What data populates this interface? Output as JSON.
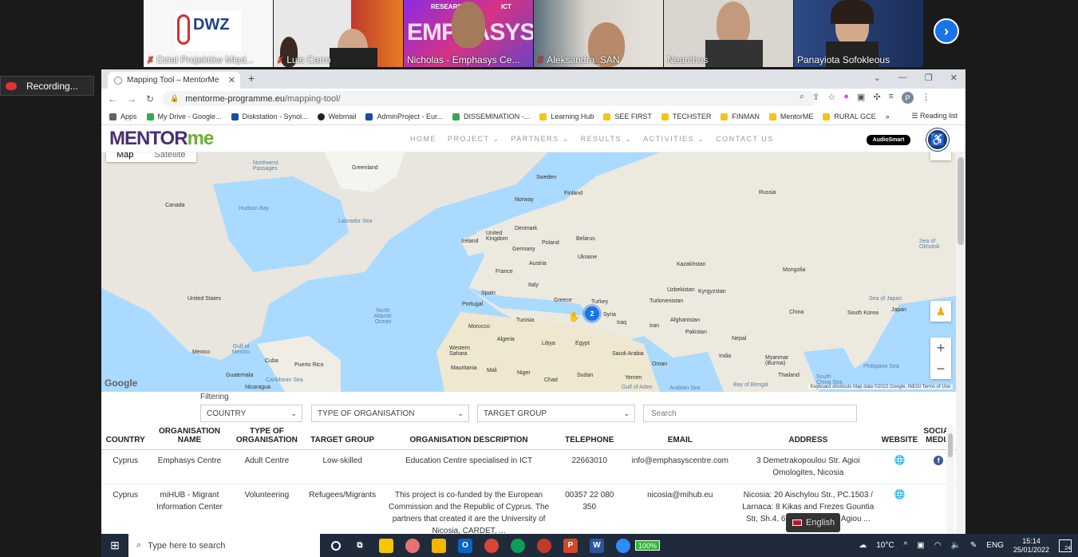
{
  "meeting": {
    "participants": [
      {
        "name": "Dział Projektów Międ...",
        "muted": true,
        "logo_text": "DWZ"
      },
      {
        "name": "Luis Carro",
        "muted": true
      },
      {
        "name": "Nicholas - Emphasys Ce...",
        "muted": false,
        "banner": "EMPHASYS",
        "banner_top": "RESEARCH",
        "banner_ict": "ICT"
      },
      {
        "name": "Aleksandra_SAN",
        "muted": true
      },
      {
        "name": "Nearchos",
        "muted": false
      },
      {
        "name": "Panayiota Sofokleous",
        "muted": false
      }
    ],
    "recording_label": "Recording...",
    "next_icon": "chevron-right-icon"
  },
  "browser": {
    "tab_title": "Mapping Tool – MentorMe",
    "url_host": "mentorme-programme.eu",
    "url_path": "/mapping-tool/",
    "profile_initial": "P",
    "bookmarks": [
      {
        "label": "Apps",
        "color": "#5f6368"
      },
      {
        "label": "My Drive - Google...",
        "color": "#34a853"
      },
      {
        "label": "Diskstation - Synol...",
        "color": "#1a4d9c"
      },
      {
        "label": "Webmail",
        "color": "#222222"
      },
      {
        "label": "AdminProject - Eur...",
        "color": "#1a4d9c"
      },
      {
        "label": "DISSEMINATION -...",
        "color": "#34a853"
      },
      {
        "label": "Learning Hub",
        "color": "#f5c518"
      },
      {
        "label": "SEE FIRST",
        "color": "#f5c518"
      },
      {
        "label": "TECHSTER",
        "color": "#f5c518"
      },
      {
        "label": "FINMAN",
        "color": "#f5c518"
      },
      {
        "label": "MentorME",
        "color": "#f5c518"
      },
      {
        "label": "RURAL GCE",
        "color": "#f5c518"
      }
    ],
    "bookmarks_more": "»",
    "reading_list": "Reading list"
  },
  "site": {
    "logo_main": "MENTOR",
    "logo_accent": "me",
    "nav": [
      "HOME",
      "PROJECT",
      "PARTNERS",
      "RESULTS",
      "ACTIVITIES",
      "CONTACT US"
    ],
    "nav_dropdowns": [
      false,
      true,
      true,
      true,
      true,
      false
    ],
    "sponsor": "AudioSmart"
  },
  "map": {
    "type_map": "Map",
    "type_satellite": "Satellite",
    "cluster_count": "2",
    "labels": [
      {
        "text": "Greenland",
        "water": false
      },
      {
        "text": "Sweden",
        "water": false
      },
      {
        "text": "Finland",
        "water": false
      },
      {
        "text": "Russia",
        "water": false
      },
      {
        "text": "Norway",
        "water": false
      },
      {
        "text": "Canada",
        "water": false
      },
      {
        "text": "Hudson Bay",
        "water": true
      },
      {
        "text": "Labrador Sea",
        "water": true
      },
      {
        "text": "Northwest Passages",
        "water": true
      },
      {
        "text": "Denmark",
        "water": false
      },
      {
        "text": "United Kingdom",
        "water": false
      },
      {
        "text": "Ireland",
        "water": false
      },
      {
        "text": "Poland",
        "water": false
      },
      {
        "text": "Belarus",
        "water": false
      },
      {
        "text": "Germany",
        "water": false
      },
      {
        "text": "Austria",
        "water": false
      },
      {
        "text": "Ukraine",
        "water": false
      },
      {
        "text": "France",
        "water": false
      },
      {
        "text": "Kazakhstan",
        "water": false
      },
      {
        "text": "Mongolia",
        "water": false
      },
      {
        "text": "Sea of Okhotsk",
        "water": true
      },
      {
        "text": "Italy",
        "water": false
      },
      {
        "text": "Spain",
        "water": false
      },
      {
        "text": "Portugal",
        "water": false
      },
      {
        "text": "Greece",
        "water": false
      },
      {
        "text": "Turkey",
        "water": false
      },
      {
        "text": "Uzbekistan",
        "water": false
      },
      {
        "text": "Kyrgyzstan",
        "water": false
      },
      {
        "text": "Turkmenistan",
        "water": false
      },
      {
        "text": "China",
        "water": false
      },
      {
        "text": "Sea of Japan",
        "water": true
      },
      {
        "text": "Japan",
        "water": false
      },
      {
        "text": "South Korea",
        "water": false
      },
      {
        "text": "United States",
        "water": false
      },
      {
        "text": "North Atlantic Ocean",
        "water": true
      },
      {
        "text": "Tunisia",
        "water": false
      },
      {
        "text": "Syria",
        "water": false
      },
      {
        "text": "Iraq",
        "water": false
      },
      {
        "text": "Iran",
        "water": false
      },
      {
        "text": "Afghanistan",
        "water": false
      },
      {
        "text": "Pakistan",
        "water": false
      },
      {
        "text": "Morocco",
        "water": false
      },
      {
        "text": "Algeria",
        "water": false
      },
      {
        "text": "Libya",
        "water": false
      },
      {
        "text": "Egypt",
        "water": false
      },
      {
        "text": "Saudi Arabia",
        "water": false
      },
      {
        "text": "Nepal",
        "water": false
      },
      {
        "text": "India",
        "water": false
      },
      {
        "text": "Mexico",
        "water": false
      },
      {
        "text": "Gulf of Mexico",
        "water": true
      },
      {
        "text": "Cuba",
        "water": false
      },
      {
        "text": "Puerto Rico",
        "water": false
      },
      {
        "text": "Western Sahara",
        "water": false
      },
      {
        "text": "Mauritania",
        "water": false
      },
      {
        "text": "Mali",
        "water": false
      },
      {
        "text": "Niger",
        "water": false
      },
      {
        "text": "Chad",
        "water": false
      },
      {
        "text": "Sudan",
        "water": false
      },
      {
        "text": "Oman",
        "water": false
      },
      {
        "text": "Yemen",
        "water": false
      },
      {
        "text": "Myanmar (Burma)",
        "water": false
      },
      {
        "text": "Thailand",
        "water": false
      },
      {
        "text": "Philippine Sea",
        "water": true
      },
      {
        "text": "South China Sea",
        "water": true
      },
      {
        "text": "Bay of Bengal",
        "water": true
      },
      {
        "text": "Arabian Sea",
        "water": true
      },
      {
        "text": "Gulf of Aden",
        "water": true
      },
      {
        "text": "Guatemala",
        "water": false
      },
      {
        "text": "Caribbean Sea",
        "water": true
      },
      {
        "text": "Nicaragua",
        "water": false
      }
    ],
    "footer": "Keyboard shortcuts    Map data ©2022 Google, INEGI    Terms of Use"
  },
  "filters": {
    "label": "Filtering",
    "country": "COUNTRY",
    "org_type": "TYPE OF ORGANISATION",
    "target_group": "TARGET GROUP",
    "search_placeholder": "Search"
  },
  "table": {
    "headers": [
      "COUNTRY",
      "ORGANISATION NAME",
      "TYPE OF ORGANISATION",
      "TARGET GROUP",
      "ORGANISATION DESCRIPTION",
      "TELEPHONE",
      "EMAIL",
      "ADDRESS",
      "WEBSITE",
      "SOCIAL MEDIA"
    ],
    "rows": [
      {
        "country": "Cyprus",
        "name": "Emphasys Centre",
        "type": "Adult Centre",
        "target": "Low-skilled",
        "description": "Education Centre specialised in ICT",
        "telephone": "22663010",
        "email": "info@emphasyscentre.com",
        "address": "3 Demetrakopoulou Str. Agioi Omologites, Nicosia",
        "has_website": true,
        "has_social": true
      },
      {
        "country": "Cyprus",
        "name": "miHUB - Migrant Information Center",
        "type": "Volunteering",
        "target": "Refugees/Migrants",
        "description": "This project is co-funded by the European Commission and the Republic of Cyprus. The partners that created it are the University of Nicosia, CARDET, ...",
        "telephone": "00357 22 080 350",
        "email": "nicosia@mihub.eu",
        "address": "Nicosia: 20 Aischylou Str., PC.1503 / Larnaca: 8 Kikas and Frezes Gountia Str, Sh.4, 6016 / Limassol: Agiou ...",
        "has_website": true,
        "has_social": false
      }
    ]
  },
  "lang_switch": "English",
  "taskbar": {
    "search_placeholder": "Type here to search",
    "battery": "100%",
    "temperature": "10°C",
    "language": "ENG",
    "time": "15:14",
    "date": "25/01/2022",
    "notifications": "24"
  }
}
